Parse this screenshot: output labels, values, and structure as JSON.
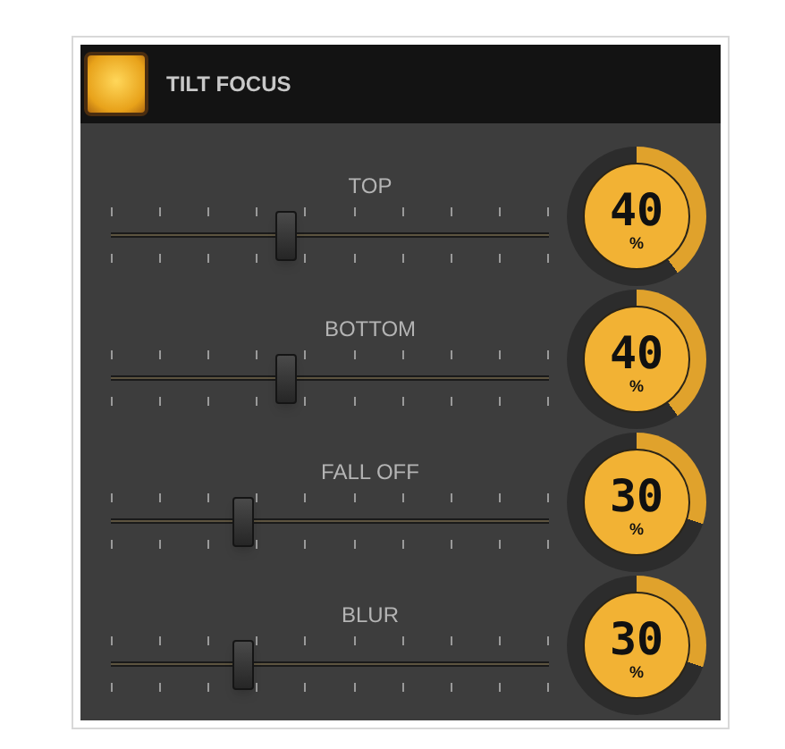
{
  "panel": {
    "title": "TILT FOCUS",
    "enabled": true
  },
  "sliders": [
    {
      "label": "TOP",
      "level": 0.4,
      "reading": "40",
      "unit": "%"
    },
    {
      "label": "BOTTOM",
      "level": 0.4,
      "reading": "40",
      "unit": "%"
    },
    {
      "label": "FALL OFF",
      "level": 0.3,
      "reading": "30",
      "unit": "%"
    },
    {
      "label": "BLUR",
      "level": 0.3,
      "reading": "30",
      "unit": "%"
    }
  ]
}
